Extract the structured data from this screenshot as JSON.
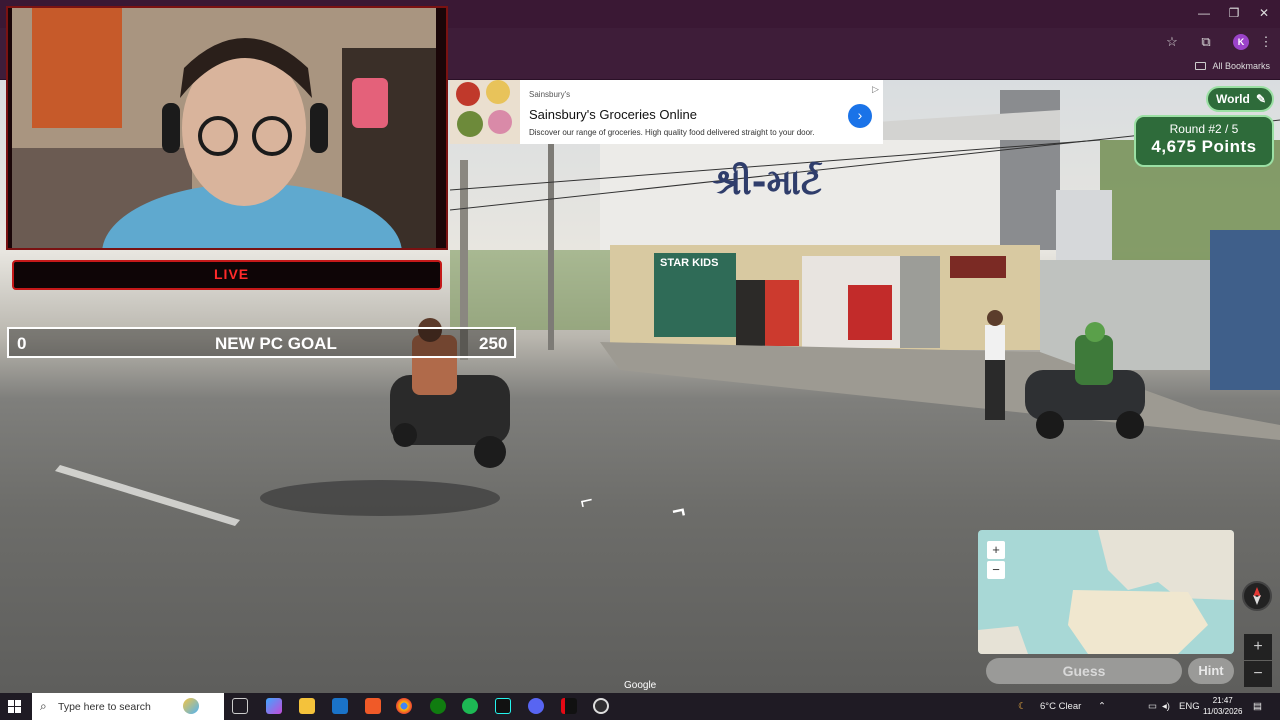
{
  "browser": {
    "window_controls": {
      "minimize": "—",
      "restore": "❐",
      "close": "✕"
    },
    "profile_initial": "K",
    "bookmarks_label": "All Bookmarks"
  },
  "stream_overlay": {
    "live_label": "LIVE",
    "goal": {
      "start": "0",
      "title": "NEW PC GOAL",
      "target": "250"
    }
  },
  "ad": {
    "brand": "Sainsbury's",
    "title": "Sainsbury's Groceries Online",
    "description": "Discover our range of groceries. High quality food delivered straight to your door.",
    "go_icon": "›",
    "adchoices_icon": "▷"
  },
  "scene": {
    "shop_sign": "શ્રી-માર્ટ",
    "poster_text": "STAR KIDS",
    "watermark": "Google",
    "nav_arrows": [
      "⌐",
      "¬"
    ]
  },
  "game": {
    "map_mode": "World",
    "round_label": "Round #2 / 5",
    "points_label": "4,675 Points",
    "guess_label": "Guess",
    "hint_label": "Hint",
    "minimap_zoom": {
      "in": "+",
      "out": "−"
    },
    "viewer_zoom": {
      "in": "+",
      "out": "−"
    }
  },
  "taskbar": {
    "search_placeholder": "Type here to search",
    "weather": "6°C  Clear",
    "language": "ENG",
    "time": "21:47",
    "date": "11/03/2026"
  }
}
